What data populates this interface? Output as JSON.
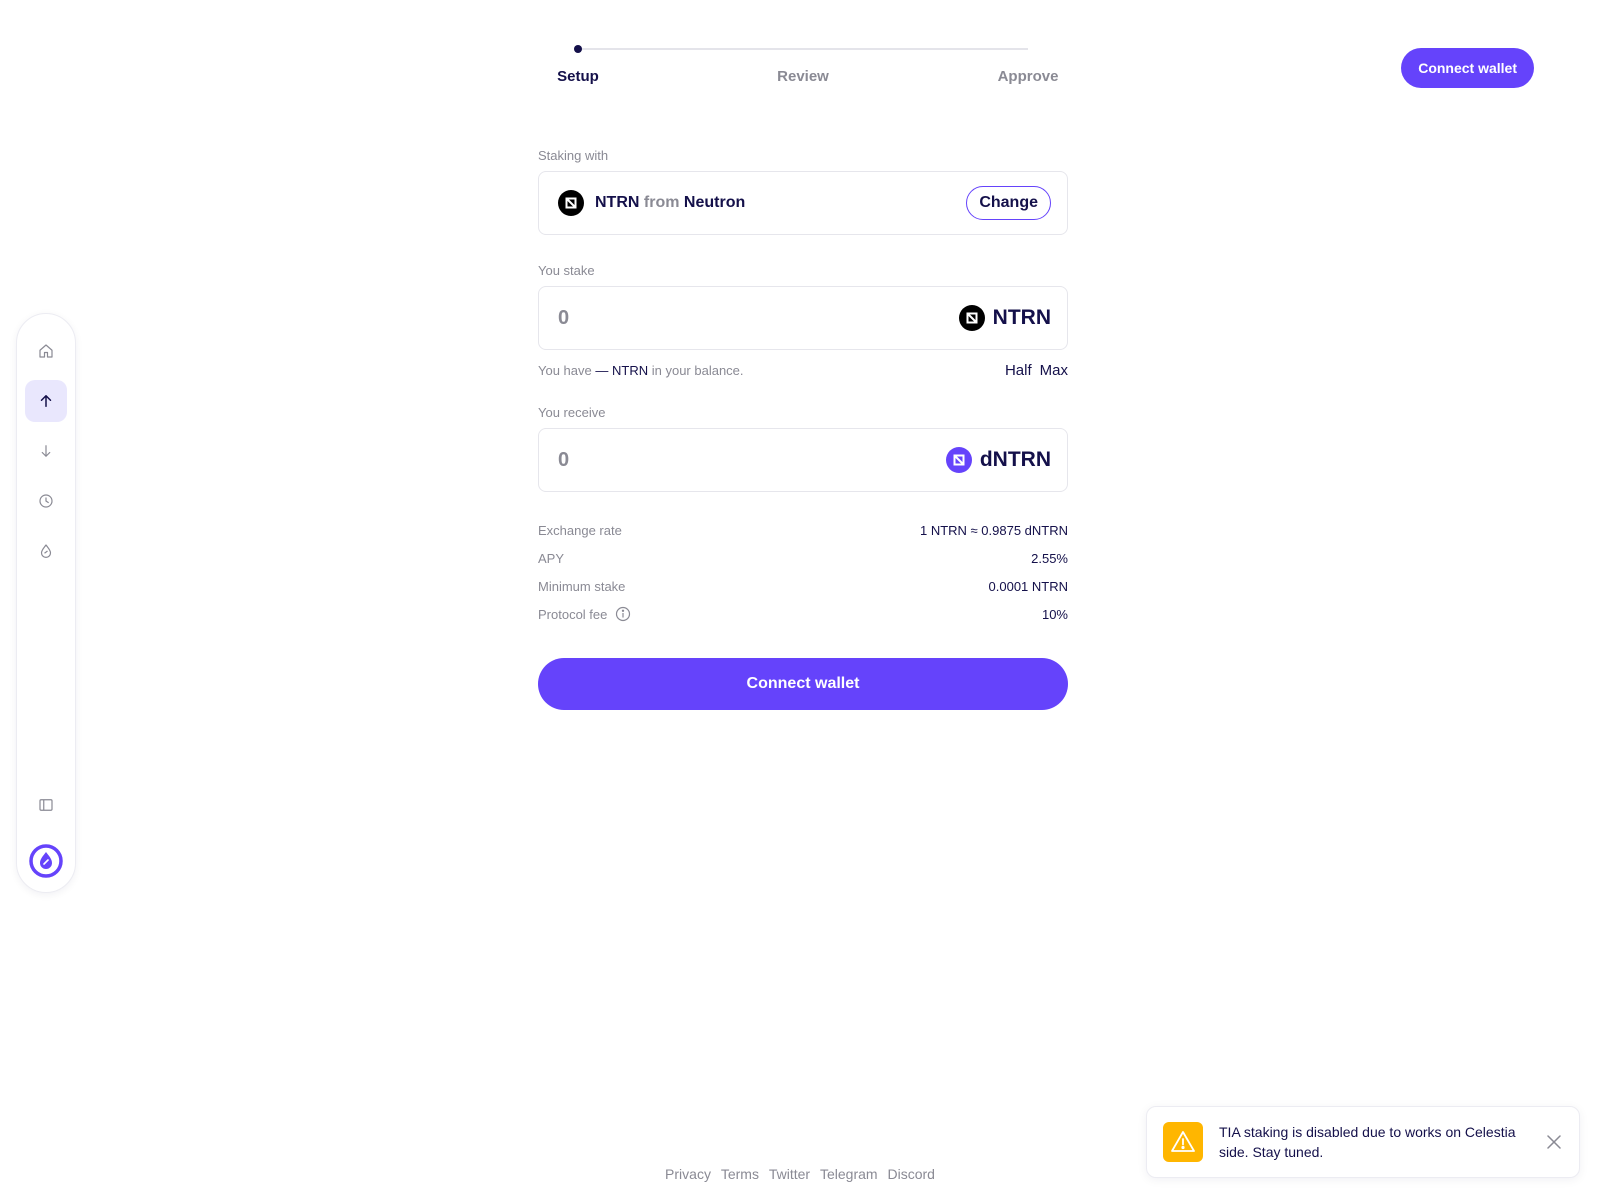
{
  "sidebar": {
    "items": [
      {
        "name": "home-icon"
      },
      {
        "name": "arrow-up-icon"
      },
      {
        "name": "arrow-down-icon"
      },
      {
        "name": "clock-icon"
      },
      {
        "name": "drop-icon"
      }
    ],
    "bottom": [
      {
        "name": "sidebar-toggle-icon"
      },
      {
        "name": "drop-logo-icon"
      }
    ]
  },
  "header": {
    "connect_label": "Connect wallet"
  },
  "stepper": {
    "steps": [
      "Setup",
      "Review",
      "Approve"
    ]
  },
  "staking_with": {
    "label": "Staking with",
    "token": "NTRN",
    "from": "from",
    "chain": "Neutron",
    "change_label": "Change"
  },
  "stake": {
    "label": "You stake",
    "placeholder": "0",
    "token": "NTRN"
  },
  "balance": {
    "prefix": "You have",
    "amount": "—",
    "token": "NTRN",
    "suffix": "in your balance.",
    "half_label": "Half",
    "max_label": "Max"
  },
  "receive": {
    "label": "You receive",
    "placeholder": "0",
    "token": "dNTRN"
  },
  "info": [
    {
      "key": "Exchange rate",
      "value": "1 NTRN ≈ 0.9875 dNTRN"
    },
    {
      "key": "APY",
      "value": "2.55%"
    },
    {
      "key": "Minimum stake",
      "value": "0.0001 NTRN"
    },
    {
      "key": "Protocol fee",
      "value": "10%"
    }
  ],
  "main": {
    "connect_label": "Connect wallet"
  },
  "footer": {
    "links": [
      "Privacy",
      "Terms",
      "Twitter",
      "Telegram",
      "Discord"
    ]
  },
  "toast": {
    "message": "TIA staking is disabled due to works on Celestia side. Stay tuned."
  },
  "colors": {
    "accent": "#6543fb",
    "text": "#14104a",
    "muted": "#8a8a94",
    "warning": "#ffb600"
  }
}
